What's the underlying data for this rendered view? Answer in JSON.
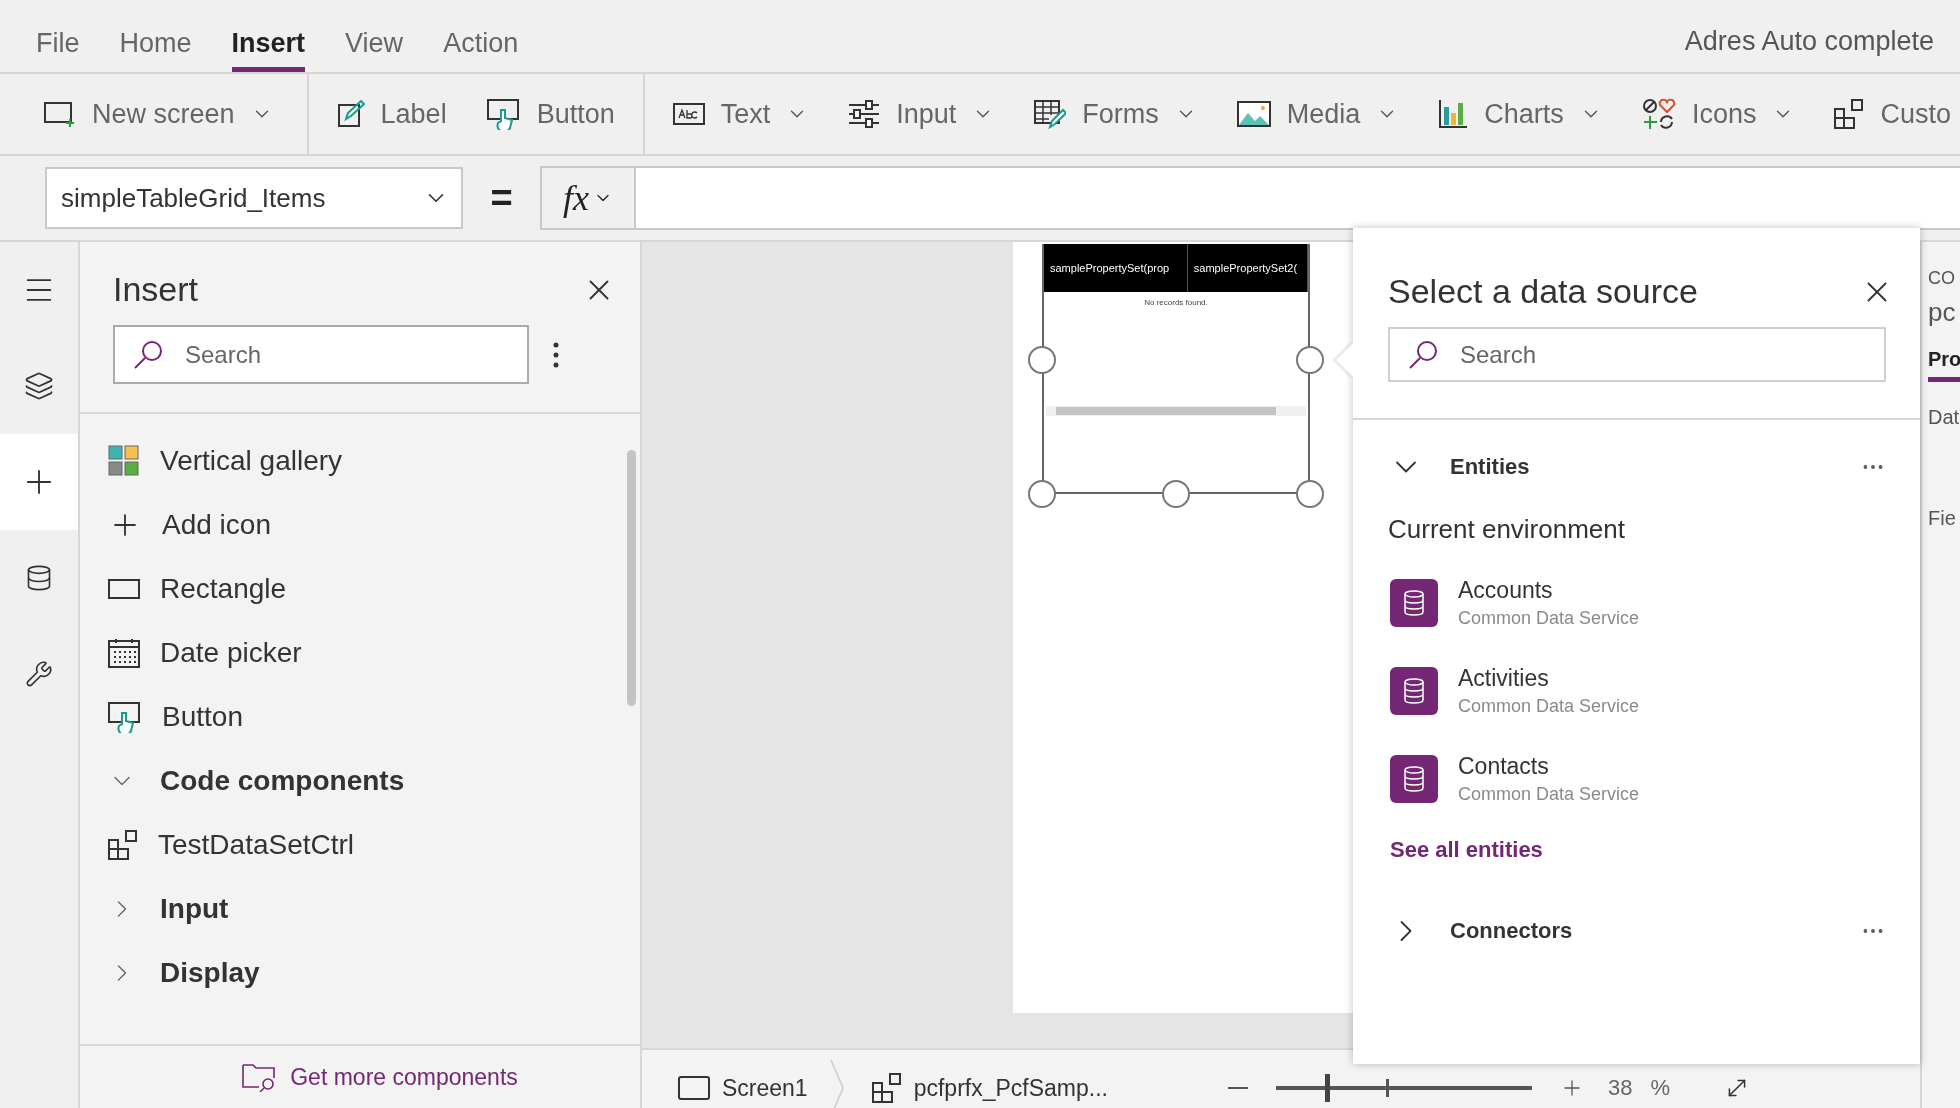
{
  "menu_tabs": [
    {
      "label": "File",
      "selected": false
    },
    {
      "label": "Home",
      "selected": false
    },
    {
      "label": "Insert",
      "selected": true
    },
    {
      "label": "View",
      "selected": false
    },
    {
      "label": "Action",
      "selected": false
    }
  ],
  "app_title": "Adres Auto complete",
  "ribbon": [
    {
      "label": "New screen",
      "dropdown": true
    },
    {
      "label": "Label",
      "dropdown": false
    },
    {
      "label": "Button",
      "dropdown": false
    },
    {
      "label": "Text",
      "dropdown": true
    },
    {
      "label": "Input",
      "dropdown": true
    },
    {
      "label": "Forms",
      "dropdown": true
    },
    {
      "label": "Media",
      "dropdown": true
    },
    {
      "label": "Charts",
      "dropdown": true
    },
    {
      "label": "Icons",
      "dropdown": true
    },
    {
      "label": "Custo",
      "dropdown": false
    }
  ],
  "formula_bar": {
    "property": "simpleTableGrid_Items",
    "operator": "=",
    "fx": "fx"
  },
  "left_rail": [
    {
      "selected": false
    },
    {
      "selected": false
    },
    {
      "selected": true
    },
    {
      "selected": false
    },
    {
      "selected": false
    }
  ],
  "insert_panel": {
    "title": "Insert",
    "search": {
      "placeholder": "Search"
    },
    "items": [
      {
        "kind": "item",
        "label": "Vertical gallery"
      },
      {
        "kind": "item",
        "label": "Add icon"
      },
      {
        "kind": "item",
        "label": "Rectangle"
      },
      {
        "kind": "item",
        "label": "Date picker"
      },
      {
        "kind": "item",
        "label": "Button"
      },
      {
        "kind": "group",
        "label": "Code components",
        "expanded": true
      },
      {
        "kind": "item",
        "label": "TestDataSetCtrl"
      },
      {
        "kind": "group",
        "label": "Input",
        "expanded": false
      },
      {
        "kind": "group",
        "label": "Display",
        "expanded": false
      }
    ],
    "footer_link": "Get more components"
  },
  "canvas_control": {
    "columns": [
      "samplePropertySet(prop",
      "samplePropertySet2("
    ],
    "empty_message": "No records found."
  },
  "data_source_panel": {
    "title": "Select a data source",
    "search": {
      "placeholder": "Search"
    },
    "sections": [
      {
        "label": "Entities",
        "expanded": true,
        "subheading": "Current environment",
        "sources": [
          {
            "name": "Accounts",
            "provider": "Common Data Service"
          },
          {
            "name": "Activities",
            "provider": "Common Data Service"
          },
          {
            "name": "Contacts",
            "provider": "Common Data Service"
          }
        ],
        "link": "See all entities"
      },
      {
        "label": "Connectors",
        "expanded": false
      }
    ]
  },
  "properties_panel": {
    "heading": "CO",
    "name": "pc",
    "tabs": [
      {
        "label": "Pro",
        "selected": true
      }
    ],
    "fields": [
      "Dat",
      "Fie"
    ]
  },
  "status_bar": {
    "screen": "Screen1",
    "component": "pcfprfx_PcfSamp...",
    "zoom": {
      "level": 0.19,
      "value": "38",
      "unit": "%"
    }
  }
}
